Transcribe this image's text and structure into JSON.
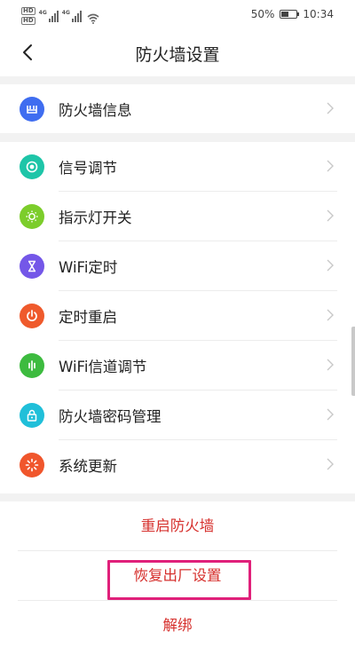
{
  "status": {
    "battery": "50%",
    "time": "10:34",
    "hd1": "HD",
    "hd2": "HD",
    "net1": "4G",
    "net2": "4G"
  },
  "header": {
    "title": "防火墙设置"
  },
  "groups": {
    "info": [
      {
        "label": "防火墙信息",
        "icon": "firewall-info-icon",
        "color": "#3f6df0"
      }
    ],
    "settings": [
      {
        "label": "信号调节",
        "icon": "signal-adjust-icon",
        "color": "#1ec5a8"
      },
      {
        "label": "指示灯开关",
        "icon": "indicator-light-icon",
        "color": "#7ccd2b"
      },
      {
        "label": "WiFi定时",
        "icon": "wifi-timer-icon",
        "color": "#7457e8"
      },
      {
        "label": "定时重启",
        "icon": "scheduled-restart-icon",
        "color": "#ef5a2c"
      },
      {
        "label": "WiFi信道调节",
        "icon": "wifi-channel-icon",
        "color": "#3dbb3f"
      },
      {
        "label": "防火墙密码管理",
        "icon": "password-lock-icon",
        "color": "#20bfd9"
      },
      {
        "label": "系统更新",
        "icon": "system-update-icon",
        "color": "#f0562c"
      }
    ]
  },
  "actions": {
    "restart": "重启防火墙",
    "factory_reset": "恢复出厂设置",
    "unbind": "解绑"
  },
  "colors": {
    "action_text": "#d6302d",
    "highlight_border": "#e0207a"
  }
}
